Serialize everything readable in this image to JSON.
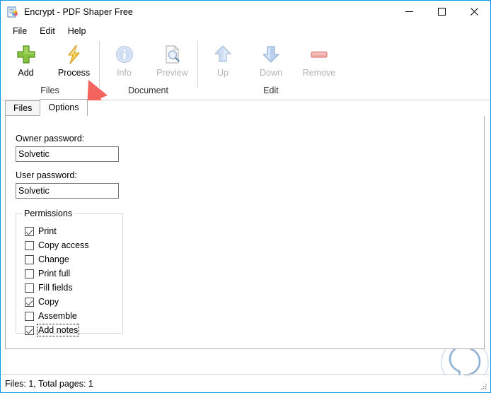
{
  "window": {
    "title": "Encrypt - PDF Shaper Free",
    "icon": "app-document-icon",
    "controls": {
      "minimize": "minimize-icon",
      "maximize": "maximize-icon",
      "close": "close-icon"
    },
    "border_color": "#0c98e6"
  },
  "menu": {
    "items": [
      {
        "label": "File"
      },
      {
        "label": "Edit"
      },
      {
        "label": "Help"
      }
    ]
  },
  "toolbar": {
    "groups": [
      {
        "label": "Files",
        "buttons": [
          {
            "label": "Add",
            "icon": "plus-icon",
            "enabled": true
          },
          {
            "label": "Process",
            "icon": "lightning-bolt-icon",
            "enabled": true
          }
        ]
      },
      {
        "label": "Document",
        "buttons": [
          {
            "label": "Info",
            "icon": "info-circle-icon",
            "enabled": false
          },
          {
            "label": "Preview",
            "icon": "document-magnifier-icon",
            "enabled": false
          }
        ]
      },
      {
        "label": "Edit",
        "buttons": [
          {
            "label": "Up",
            "icon": "arrow-up-icon",
            "enabled": false
          },
          {
            "label": "Down",
            "icon": "arrow-down-icon",
            "enabled": false
          },
          {
            "label": "Remove",
            "icon": "minus-bar-icon",
            "enabled": false
          }
        ]
      }
    ]
  },
  "tabs": [
    {
      "label": "Files",
      "active": false
    },
    {
      "label": "Options",
      "active": true
    }
  ],
  "options_panel": {
    "owner_password": {
      "label": "Owner password:",
      "value": "Solvetic",
      "placeholder": ""
    },
    "user_password": {
      "label": "User password:",
      "value": "Solvetic",
      "placeholder": ""
    },
    "permissions": {
      "title": "Permissions",
      "items": [
        {
          "label": "Print",
          "checked": true,
          "focused": false
        },
        {
          "label": "Copy access",
          "checked": false,
          "focused": false
        },
        {
          "label": "Change",
          "checked": false,
          "focused": false
        },
        {
          "label": "Print full",
          "checked": false,
          "focused": false
        },
        {
          "label": "Fill fields",
          "checked": false,
          "focused": false
        },
        {
          "label": "Copy",
          "checked": true,
          "focused": false
        },
        {
          "label": "Assemble",
          "checked": false,
          "focused": false
        },
        {
          "label": "Add notes",
          "checked": true,
          "focused": true
        }
      ]
    }
  },
  "statusbar": {
    "text": "Files: 1, Total pages: 1"
  },
  "annotations": [
    {
      "name": "arrow-pointing-to-process-button",
      "direction": "up-left",
      "color": "#f4635e"
    },
    {
      "name": "arrow-pointing-to-owner-password",
      "direction": "left",
      "color": "#f4635e"
    }
  ],
  "watermark": {
    "name": "solvetic-balloon-logo",
    "color": "#6f9fd0"
  }
}
